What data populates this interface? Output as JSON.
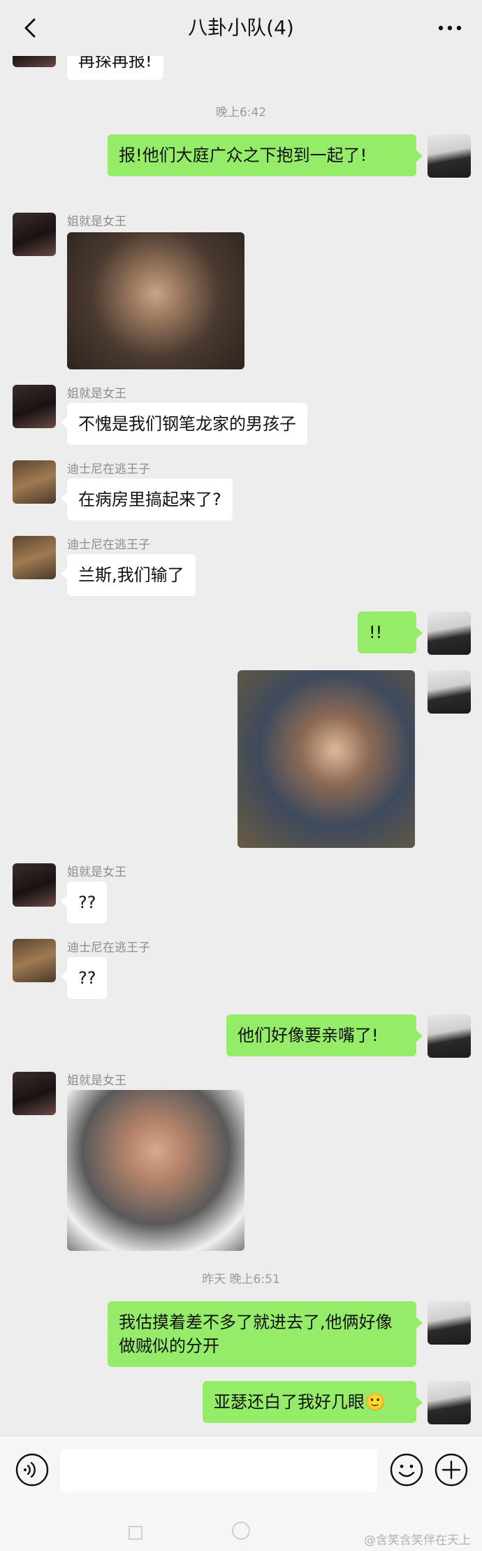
{
  "header": {
    "title": "八卦小队(4)",
    "back_icon": "chevron-left-icon",
    "more_icon": "more-dots-icon"
  },
  "messages": {
    "m0": {
      "text": "再探再报!"
    },
    "t1": "晚上6:42",
    "m1": {
      "text": "报!他们大庭广众之下抱到一起了!"
    },
    "m2": {
      "sender": "姐就是女王"
    },
    "m3": {
      "sender": "姐就是女王",
      "text": "不愧是我们钢笔龙家的男孩子"
    },
    "m4": {
      "sender": "迪士尼在逃王子",
      "text": "在病房里搞起来了?"
    },
    "m5": {
      "sender": "迪士尼在逃王子",
      "text": "兰斯,我们输了"
    },
    "m6": {
      "text": "!!"
    },
    "m8": {
      "sender": "姐就是女王",
      "text": "??"
    },
    "m9": {
      "sender": "迪士尼在逃王子",
      "text": "??"
    },
    "m10": {
      "text": "他们好像要亲嘴了!"
    },
    "m11": {
      "sender": "姐就是女王"
    },
    "t2": "昨天 晚上6:51",
    "m12": {
      "text": "我估摸着差不多了就进去了,他俩好像做贼似的分开"
    },
    "m13": {
      "text": "亚瑟还白了我好几眼🙂"
    }
  },
  "input_bar": {
    "voice_icon": "voice-icon",
    "emoji_icon": "emoji-icon",
    "plus_icon": "plus-icon"
  },
  "watermark": "@含笑含笑伴在天上"
}
